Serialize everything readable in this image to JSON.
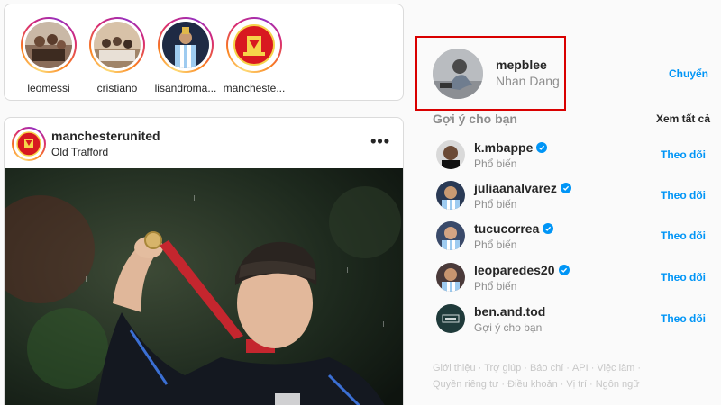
{
  "stories": [
    {
      "username": "leomessi"
    },
    {
      "username": "cristiano"
    },
    {
      "username": "lisandroma..."
    },
    {
      "username": "mancheste..."
    }
  ],
  "post": {
    "username": "manchesterunited",
    "location": "Old Trafford",
    "more_icon": "more-horizontal-icon"
  },
  "current_user": {
    "username": "mepblee",
    "full_name": "Nhan Dang",
    "switch_label": "Chuyển"
  },
  "suggestions": {
    "title": "Gợi ý cho bạn",
    "see_all": "Xem tất cả",
    "items": [
      {
        "username": "k.mbappe",
        "subtitle": "Phổ biến",
        "verified": true,
        "action": "Theo dõi"
      },
      {
        "username": "juliaanalvarez",
        "subtitle": "Phổ biến",
        "verified": true,
        "action": "Theo dõi"
      },
      {
        "username": "tucucorrea",
        "subtitle": "Phổ biến",
        "verified": true,
        "action": "Theo dõi"
      },
      {
        "username": "leoparedes20",
        "subtitle": "Phổ biến",
        "verified": true,
        "action": "Theo dõi"
      },
      {
        "username": "ben.and.tod",
        "subtitle": "Gợi ý cho bạn",
        "verified": false,
        "action": "Theo dõi"
      }
    ]
  },
  "footer": {
    "line1": [
      "Giới thiệu",
      "Trợ giúp",
      "Báo chí",
      "API",
      "Việc làm"
    ],
    "line2": [
      "Quyền riêng tư",
      "Điều khoản",
      "Vị trí",
      "Ngôn ngữ"
    ]
  },
  "colors": {
    "link_blue": "#0095f6",
    "verified_blue": "#0095f6",
    "highlight_red": "#d90000",
    "muted_text": "#8e8e8e"
  }
}
